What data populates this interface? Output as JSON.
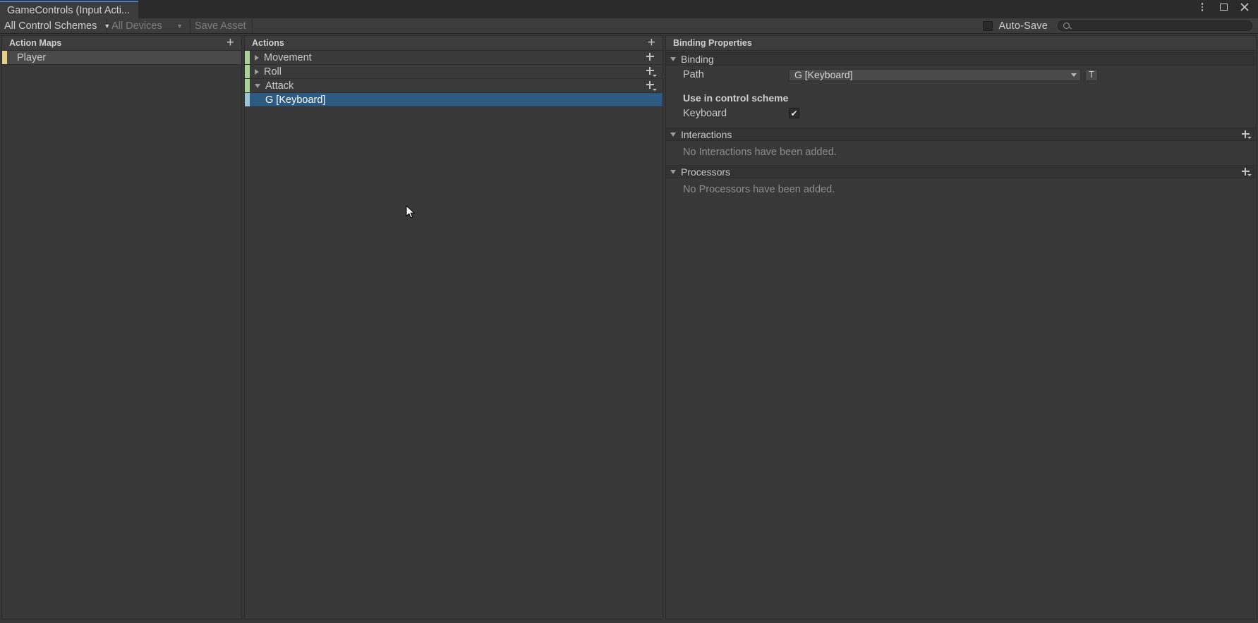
{
  "window": {
    "tab_title": "GameControls (Input Acti...",
    "icons": {
      "menu": "kebab-menu-icon",
      "maximize": "maximize-icon",
      "close": "close-icon"
    },
    "accent_color": "#4b7ec7"
  },
  "toolbar": {
    "control_scheme": "All Control Schemes",
    "devices": "All Devices",
    "save_asset": "Save Asset",
    "auto_save_label": "Auto-Save",
    "auto_save_checked": false,
    "search_value": "",
    "search_placeholder": ""
  },
  "action_maps": {
    "header": "Action Maps",
    "add_label": "+",
    "accent_color": "#e3cf85",
    "items": [
      {
        "name": "Player",
        "selected": true
      }
    ]
  },
  "actions": {
    "header": "Actions",
    "add_label": "+",
    "accent_color": "#a9d39a",
    "binding_accent_color": "#9ec3d6",
    "selection_color": "#2d5a80",
    "items": [
      {
        "name": "Movement",
        "type": "action",
        "expanded": false
      },
      {
        "name": "Roll",
        "type": "action",
        "expanded": false
      },
      {
        "name": "Attack",
        "type": "action",
        "expanded": true
      },
      {
        "name": "G [Keyboard]",
        "type": "binding",
        "selected": true
      }
    ]
  },
  "binding_properties": {
    "header": "Binding Properties",
    "sections": {
      "binding": {
        "title": "Binding",
        "expanded": true,
        "path_label": "Path",
        "path_value": "G [Keyboard]",
        "path_toggle_label": "T",
        "control_scheme_title": "Use in control scheme",
        "schemes": [
          {
            "name": "Keyboard",
            "checked": true,
            "check_glyph": "✔"
          }
        ]
      },
      "interactions": {
        "title": "Interactions",
        "expanded": true,
        "empty_text": "No Interactions have been added."
      },
      "processors": {
        "title": "Processors",
        "expanded": true,
        "empty_text": "No Processors have been added."
      }
    }
  }
}
